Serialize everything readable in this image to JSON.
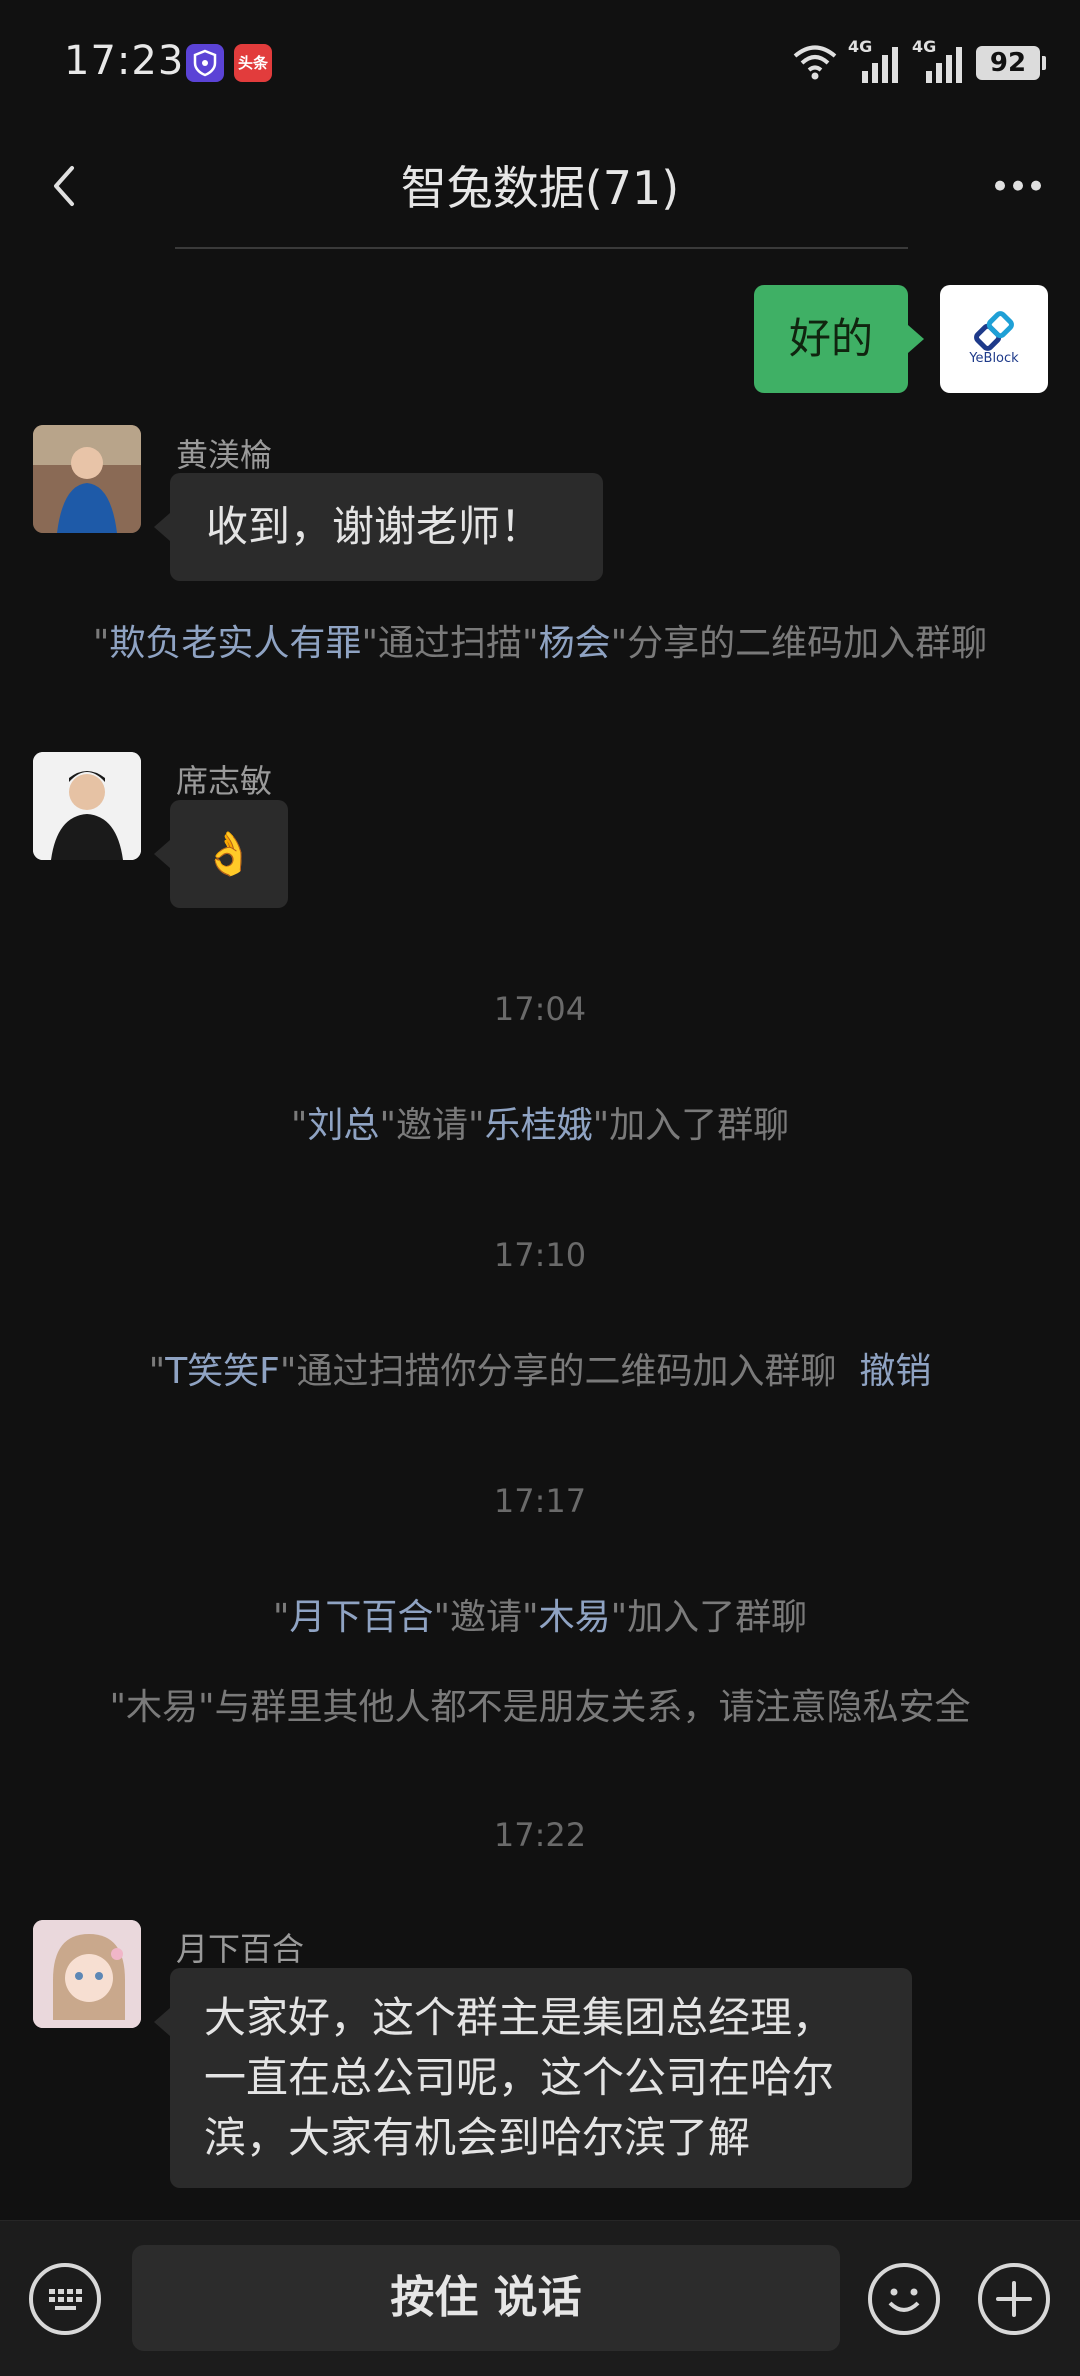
{
  "status_bar": {
    "time": "17:23",
    "toutiao_label": "头条",
    "battery": "92",
    "network_1": "4G",
    "network_2": "4G"
  },
  "header": {
    "title": "智兔数据(71)"
  },
  "messages": {
    "outgoing_1": {
      "text": "好的",
      "avatar_label": "YeBlock"
    },
    "incoming_1": {
      "sender": "黄渼棆",
      "text": "收到，谢谢老师！"
    },
    "system_1": {
      "part1": "\"",
      "name1": "欺负老实人有罪",
      "part2": "\"通过扫描\"",
      "name2": "杨会",
      "part3": "\"分享的二维码加入群聊"
    },
    "incoming_2": {
      "sender": "席志敏",
      "text": "👌"
    },
    "time_1": "17:04",
    "system_2": {
      "part1": "\"",
      "name1": "刘总",
      "part2": "\"邀请\"",
      "name2": "乐桂娥",
      "part3": "\"加入了群聊"
    },
    "time_2": "17:10",
    "system_3": {
      "part1": "\"",
      "name1": "T笑笑F",
      "part2": "\"通过扫描你分享的二维码加入群聊",
      "action": "撤销"
    },
    "time_3": "17:17",
    "system_4": {
      "part1": "\"",
      "name1": "月下百合",
      "part2": "\"邀请\"",
      "name2": "木易",
      "part3": "\"加入了群聊"
    },
    "system_5": {
      "text": "\"木易\"与群里其他人都不是朋友关系，请注意隐私安全"
    },
    "time_4": "17:22",
    "incoming_3": {
      "sender": "月下百合",
      "line1": "大家好，这个群主是集团总经理，",
      "line2": "一直在总公司呢，这个公司在哈尔",
      "line3": "滨，大家有机会到哈尔滨了解"
    }
  },
  "input_bar": {
    "hold_to_talk_label": "按住 说话"
  },
  "colors": {
    "background": "#111111",
    "bubble_incoming": "#2b2b2b",
    "bubble_outgoing": "#3fb065",
    "highlight_name": "#8fa3c3"
  },
  "icons": [
    "back-arrow-icon",
    "more-dots-icon",
    "keyboard-icon",
    "emoji-icon",
    "plus-icon",
    "wifi-icon",
    "signal-icon",
    "battery-icon"
  ]
}
